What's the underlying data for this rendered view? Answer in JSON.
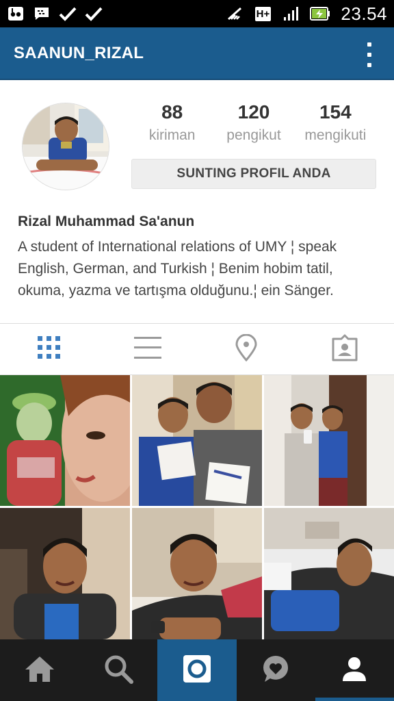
{
  "status_bar": {
    "time": "23.54",
    "network": "H+",
    "left_icons": [
      "voicemail-icon",
      "bbm-icon",
      "check-icon",
      "check-icon"
    ],
    "right_icons": [
      "muted-icon",
      "network-type-icon",
      "signal-icon",
      "battery-charging-icon"
    ]
  },
  "app_bar": {
    "title": "SAANUN_RIZAL",
    "menu_icon": "overflow-menu-icon"
  },
  "profile": {
    "stats": [
      {
        "value": "88",
        "label": "kiriman"
      },
      {
        "value": "120",
        "label": "pengikut"
      },
      {
        "value": "154",
        "label": "mengikuti"
      }
    ],
    "edit_button_label": "SUNTING PROFIL ANDA",
    "full_name": "Rizal Muhammad Sa'anun",
    "bio": "A student of International relations of UMY ¦ speak English, German, and Turkish ¦ Benim hobim tatil, okuma, yazma ve tartışma olduğunu.¦ ein Sänger."
  },
  "view_tabs": [
    {
      "icon": "grid-view-icon",
      "active": true
    },
    {
      "icon": "list-view-icon",
      "active": false
    },
    {
      "icon": "location-pin-icon",
      "active": false
    },
    {
      "icon": "tagged-photos-icon",
      "active": false
    }
  ],
  "colors": {
    "brand_blue": "#1b5c8e",
    "active_tab": "#3f7fc0",
    "inactive_tab": "#9a9a9a",
    "nav_bg": "#1c1c1c"
  },
  "bottom_nav": [
    {
      "icon": "home-icon",
      "active": false
    },
    {
      "icon": "search-icon",
      "active": false
    },
    {
      "icon": "camera-icon",
      "active": false
    },
    {
      "icon": "activity-heart-icon",
      "active": false
    },
    {
      "icon": "profile-icon",
      "active": true
    }
  ]
}
